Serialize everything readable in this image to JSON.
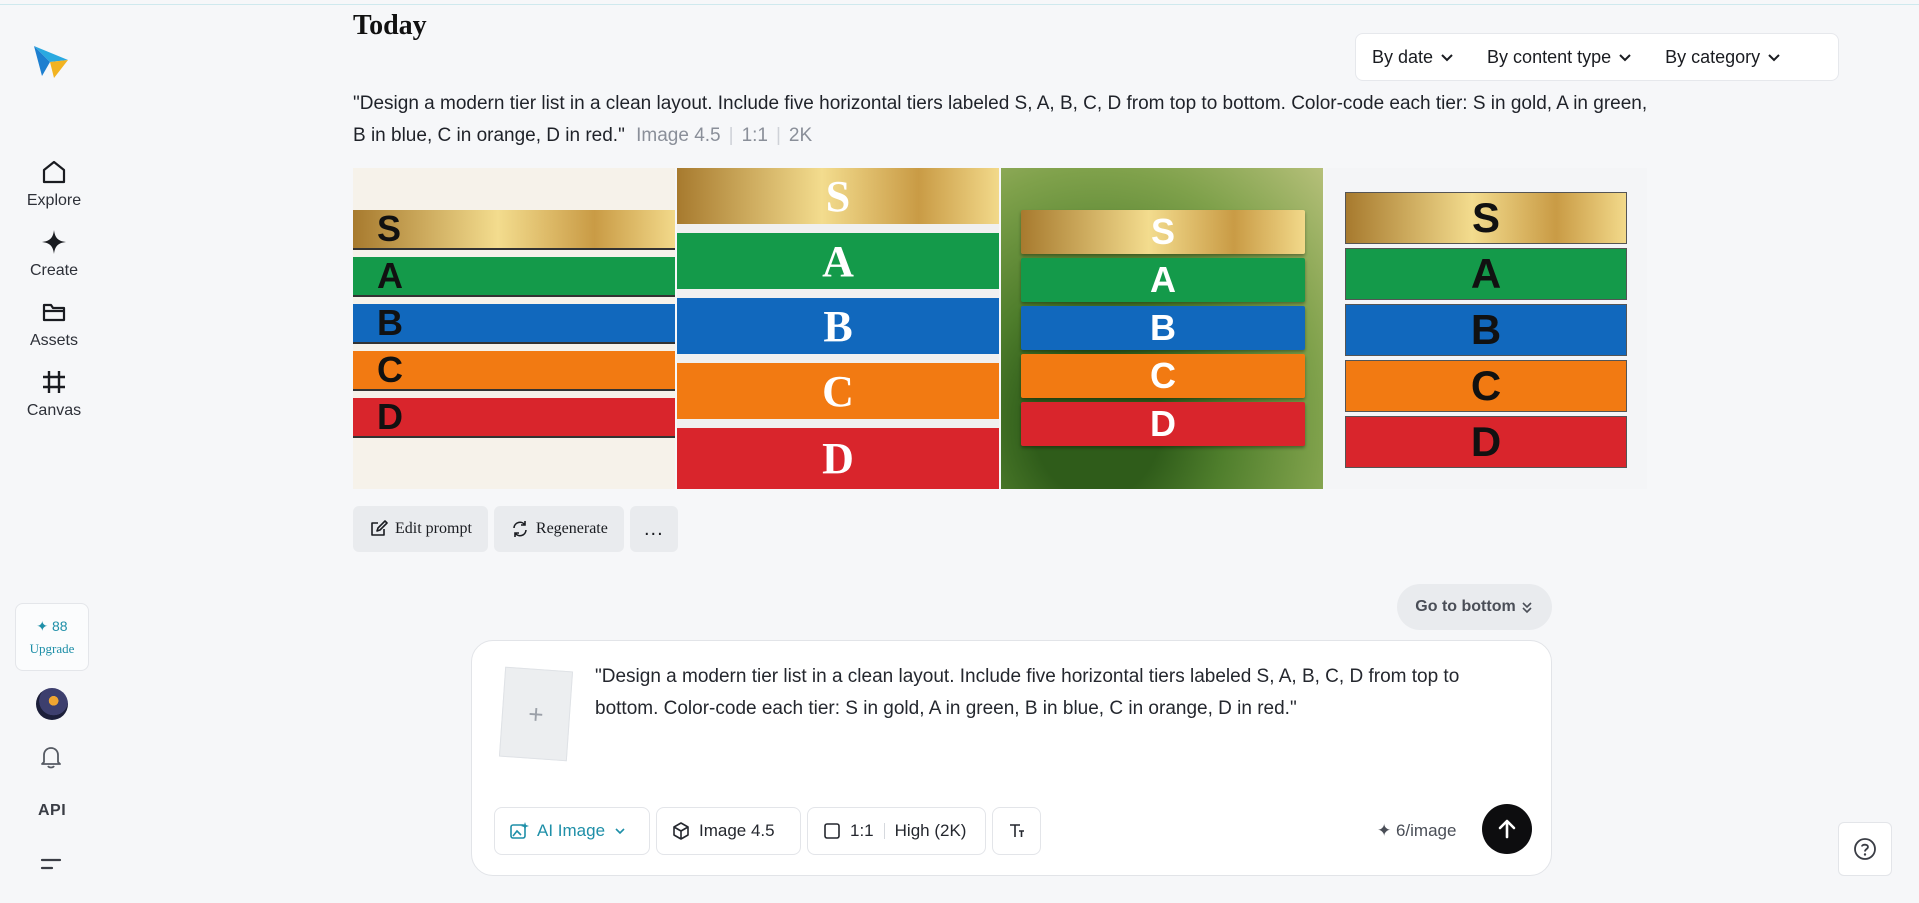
{
  "sidebar": {
    "items": [
      {
        "label": "Explore",
        "icon": "home-icon"
      },
      {
        "label": "Create",
        "icon": "sparkle-icon"
      },
      {
        "label": "Assets",
        "icon": "folder-icon"
      },
      {
        "label": "Canvas",
        "icon": "canvas-icon"
      }
    ],
    "credits": "88",
    "upgrade_label": "Upgrade",
    "api_label": "API"
  },
  "header": {
    "title": "Today",
    "filters": [
      "By date",
      "By content type",
      "By category"
    ]
  },
  "generation": {
    "prompt": "\"Design a modern tier list in a clean layout. Include five horizontal tiers labeled S, A, B, C, D from top to bottom. Color-code each tier: S in gold, A in green, B in blue, C in orange, D in red.\"",
    "model": "Image 4.5",
    "ratio": "1:1",
    "resolution": "2K",
    "tiers": [
      "S",
      "A",
      "B",
      "C",
      "D"
    ],
    "tier_colors": {
      "S": "#d4b060",
      "A": "#149a4a",
      "B": "#1168bd",
      "C": "#f27a12",
      "D": "#d9252c"
    }
  },
  "actions": {
    "edit_prompt": "Edit prompt",
    "regenerate": "Regenerate",
    "more": "..."
  },
  "go_bottom": "Go to bottom",
  "composer": {
    "text": "\"Design a modern tier list in a clean layout. Include five horizontal tiers labeled S, A, B, C, D from top to bottom. Color-code each tier: S in gold, A in green, B in blue, C in orange, D in red.\"",
    "mode": "AI Image",
    "model": "Image 4.5",
    "ratio": "1:1",
    "quality": "High (2K)",
    "cost": "6/image"
  },
  "colors": {
    "accent": "#1e8fa8",
    "background": "#f6f7f9"
  }
}
